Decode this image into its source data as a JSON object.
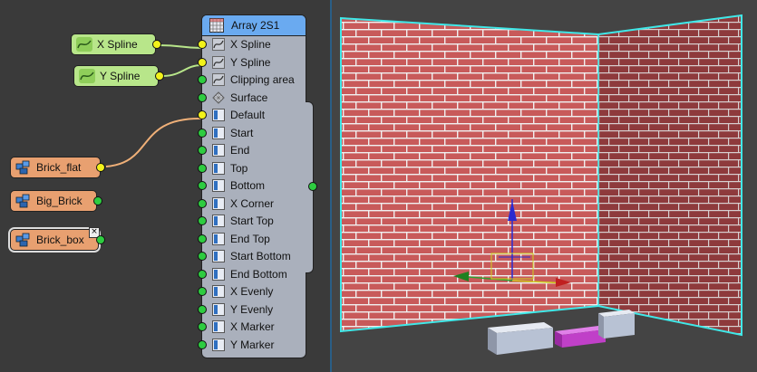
{
  "graph": {
    "array_node": {
      "title": "Array 2S1",
      "inputs": [
        {
          "label": "X Spline",
          "icon": "spline-icon",
          "port": "yellow"
        },
        {
          "label": "Y Spline",
          "icon": "spline-icon",
          "port": "yellow"
        },
        {
          "label": "Clipping area",
          "icon": "spline-icon",
          "port": "green"
        },
        {
          "label": "Surface",
          "icon": "surface-icon",
          "port": "green"
        },
        {
          "label": "Default",
          "icon": "brick-slot-icon",
          "port": "yellow"
        },
        {
          "label": "Start",
          "icon": "brick-slot-icon",
          "port": "green"
        },
        {
          "label": "End",
          "icon": "brick-slot-icon",
          "port": "green"
        },
        {
          "label": "Top",
          "icon": "brick-slot-icon",
          "port": "green"
        },
        {
          "label": "Bottom",
          "icon": "brick-slot-icon",
          "port": "green"
        },
        {
          "label": "X Corner",
          "icon": "brick-slot-icon",
          "port": "green"
        },
        {
          "label": "Start Top",
          "icon": "brick-slot-icon",
          "port": "green"
        },
        {
          "label": "End Top",
          "icon": "brick-slot-icon",
          "port": "green"
        },
        {
          "label": "Start Bottom",
          "icon": "brick-slot-icon",
          "port": "green"
        },
        {
          "label": "End Bottom",
          "icon": "brick-slot-icon",
          "port": "green"
        },
        {
          "label": "X Evenly",
          "icon": "brick-slot-icon",
          "port": "green"
        },
        {
          "label": "Y Evenly",
          "icon": "brick-slot-icon",
          "port": "green"
        },
        {
          "label": "X Marker",
          "icon": "brick-slot-icon",
          "port": "green"
        },
        {
          "label": "Y Marker",
          "icon": "brick-slot-icon",
          "port": "green"
        }
      ]
    },
    "spline_nodes": [
      {
        "label": "X Spline",
        "icon": "spline-icon"
      },
      {
        "label": "Y Spline",
        "icon": "spline-icon"
      }
    ],
    "brick_nodes": [
      {
        "label": "Brick_flat",
        "icon": "brick-object-icon",
        "port": "yellow"
      },
      {
        "label": "Big_Brick",
        "icon": "brick-object-icon",
        "port": "green"
      },
      {
        "label": "Brick_box",
        "icon": "brick-object-icon",
        "port": "green",
        "close_glyph": "×"
      }
    ]
  },
  "colors": {
    "graph_bg": "#3a3a3a",
    "viewport_bg": "#444444",
    "header_blue": "#6aaaf0",
    "spline_node": "#b8e68a",
    "brick_node": "#e8a070",
    "port_yellow": "#f2f21a",
    "port_green": "#2ecc40",
    "brick_red": "#c85a5a",
    "mortar": "#f0f0f0",
    "selection_cyan": "#3fe8e8",
    "magenta_box": "#c040c8"
  }
}
